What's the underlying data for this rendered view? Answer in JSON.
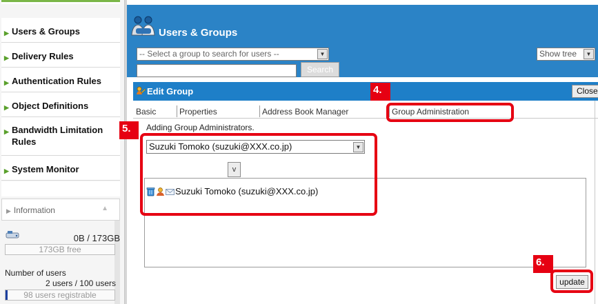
{
  "sidebar": {
    "nav": [
      {
        "label": "Users & Groups"
      },
      {
        "label": "Delivery Rules"
      },
      {
        "label": "Authentication Rules"
      },
      {
        "label": "Object Definitions"
      },
      {
        "label": "Bandwidth Limitation Rules"
      },
      {
        "label": "System Monitor"
      }
    ],
    "information": {
      "label": "Information",
      "disk_used": "0B /  173GB",
      "disk_free": "173GB free",
      "users_label": "Number of users",
      "users_count": "2 users / 100 users",
      "users_registrable": "98 users registrable",
      "users_fraction": 0.02
    }
  },
  "header": {
    "title": "Users & Groups",
    "group_select": "-- Select a group to search for users --",
    "search_value": "",
    "search_button": "Search",
    "tree_select": "Show tree"
  },
  "edit_group": {
    "title": "Edit Group",
    "close_button": "Close",
    "tabs": [
      {
        "label": "Basic"
      },
      {
        "label": "Properties"
      },
      {
        "label": "Address Book Manager"
      },
      {
        "label": "Group Administration"
      }
    ],
    "section_heading": "Adding Group Administrators.",
    "admin_select": "Suzuki Tomoko (suzuki@XXX.co.jp)",
    "add_button": "v",
    "admins": [
      {
        "name": "Suzuki Tomoko (suzuki@XXX.co.jp)"
      }
    ],
    "update_button": "update"
  },
  "callouts": {
    "step4": "4.",
    "step5": "5.",
    "step6": "6."
  },
  "colors": {
    "header_blue": "#2b83c6",
    "accent_red": "#e60012",
    "nav_green": "#5aa02c"
  },
  "icons": [
    "users-groups-icon",
    "edit-group-icon",
    "trash-icon",
    "user-icon",
    "mail-icon",
    "disk-icon",
    "dropdown-arrow-icon",
    "scroll-up-icon"
  ]
}
